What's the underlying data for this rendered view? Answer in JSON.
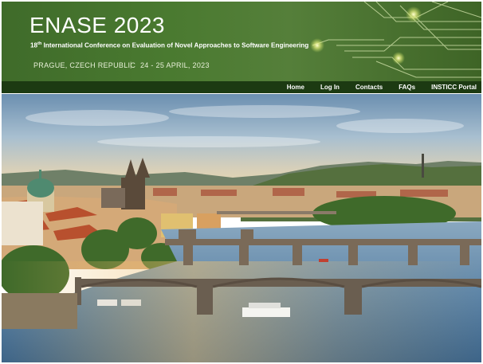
{
  "header": {
    "title": "ENASE 2023",
    "edition_number": "18",
    "edition_suffix": "th",
    "conference_name": " International Conference on Evaluation of Novel Approaches to Software Engineering",
    "location": "PRAGUE, CZECH REPUBLIC",
    "separator": "|",
    "dates": "24 - 25 APRIL, 2023"
  },
  "nav": {
    "items": [
      "Home",
      "Log In",
      "Contacts",
      "FAQs",
      "INSTICC Portal"
    ]
  },
  "colors": {
    "banner_green": "#4a7a30",
    "navbar": "#1c3a12",
    "text": "#ffffff"
  }
}
